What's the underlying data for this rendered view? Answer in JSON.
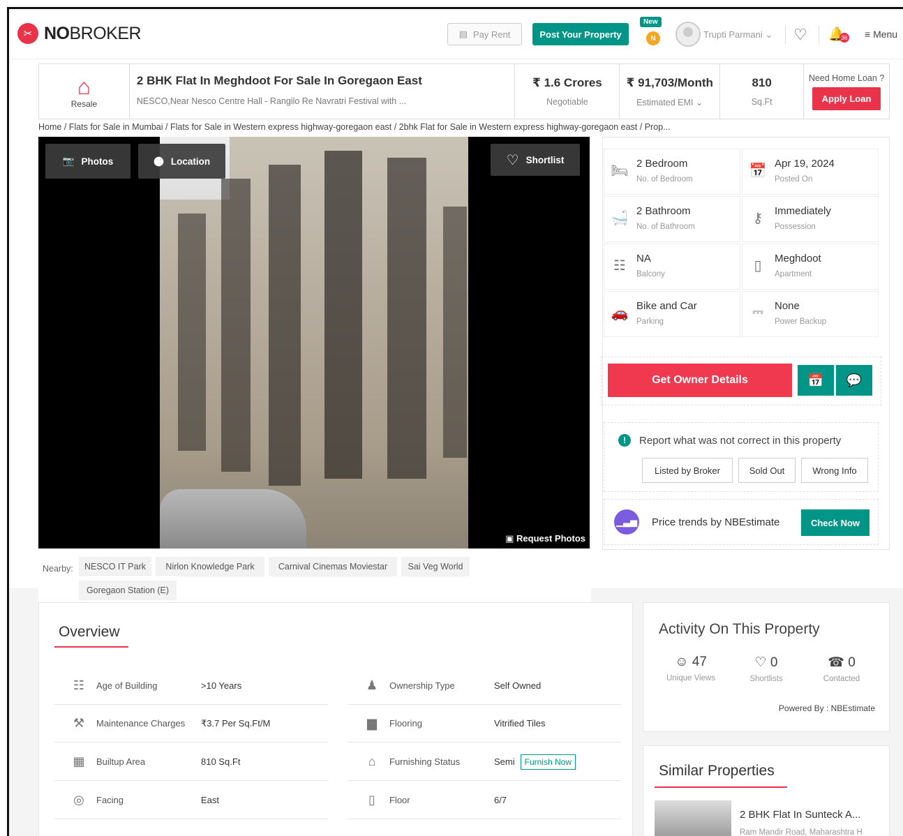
{
  "header": {
    "brand_no": "NO",
    "brand_rest": "BROKER",
    "pay_rent": "Pay Rent",
    "post_property": "Post Your Property",
    "new_badge": "New",
    "new_icon_letter": "N",
    "user_name": "Trupti Parmani",
    "notif_count": "36",
    "menu": "Menu"
  },
  "listing": {
    "resale_label": "Resale",
    "title": "2 BHK Flat In Meghdoot For Sale In Goregaon East",
    "address": "NESCO,Near Nesco Centre Hall - Rangilo Re Navratri Festival with ...",
    "price": "₹ 1.6 Crores",
    "price_sub": "Negotiable",
    "emi": "₹ 91,703/Month",
    "emi_sub": "Estimated EMI",
    "area": "810",
    "area_sub": "Sq.Ft",
    "loan_q": "Need Home Loan ?",
    "loan_btn": "Apply Loan"
  },
  "breadcrumb": "Home / Flats for Sale in Mumbai / Flats for Sale in Western express highway-goregaon east / 2bhk Flat for Sale in Western express highway-goregaon east / Prop...",
  "photo": {
    "photos_btn": "Photos",
    "location_btn": "Location",
    "shortlist_btn": "Shortlist",
    "request_photos": "Request Photos"
  },
  "details": [
    {
      "value": "2 Bedroom",
      "label": "No. of Bedroom",
      "icon": "bed-icon"
    },
    {
      "value": "Apr 19, 2024",
      "label": "Posted On",
      "icon": "calendar-icon"
    },
    {
      "value": "2 Bathroom",
      "label": "No. of Bathroom",
      "icon": "bath-icon"
    },
    {
      "value": "Immediately",
      "label": "Possession",
      "icon": "key-icon"
    },
    {
      "value": "NA",
      "label": "Balcony",
      "icon": "balcony-icon"
    },
    {
      "value": "Meghdoot",
      "label": "Apartment",
      "icon": "building-icon"
    },
    {
      "value": "Bike and Car",
      "label": "Parking",
      "icon": "car-icon"
    },
    {
      "value": "None",
      "label": "Power Backup",
      "icon": "battery-icon"
    }
  ],
  "owner_btn": "Get Owner Details",
  "report": {
    "text": "Report what was not correct in this property",
    "listed_by_broker": "Listed by Broker",
    "sold_out": "Sold Out",
    "wrong_info": "Wrong Info"
  },
  "trend": {
    "text": "Price trends by NBEstimate",
    "btn": "Check Now"
  },
  "nearby": {
    "label": "Nearby:",
    "items": [
      "NESCO IT Park",
      "Nirlon Knowledge Park",
      "Carnival Cinemas Moviestar",
      "Sai Veg World",
      "Goregaon Station (E)"
    ]
  },
  "overview": {
    "title": "Overview",
    "rows_left": [
      {
        "key": "Age of Building",
        "value": ">10 Years"
      },
      {
        "key": "Maintenance Charges",
        "value": "₹3.7 Per Sq.Ft/M"
      },
      {
        "key": "Builtup Area",
        "value": "810 Sq.Ft"
      },
      {
        "key": "Facing",
        "value": "East"
      }
    ],
    "rows_right": [
      {
        "key": "Ownership Type",
        "value": "Self Owned"
      },
      {
        "key": "Flooring",
        "value": "Vitrified Tiles"
      },
      {
        "key": "Furnishing Status",
        "value": "Semi"
      },
      {
        "key": "Floor",
        "value": "6/7"
      }
    ],
    "furnish_now": "Furnish Now"
  },
  "activity": {
    "title": "Activity On This Property",
    "unique_views": "47",
    "unique_views_label": "Unique Views",
    "shortlists": "0",
    "shortlists_label": "Shortlists",
    "contacted": "0",
    "contacted_label": "Contacted",
    "powered_by": "Powered By :",
    "powered_name": "NBEstimate"
  },
  "similar": {
    "title": "Similar Properties",
    "item_title": "2 BHK Flat In Sunteck A...",
    "item_sub": "Ram Mandir Road, Maharashtra H"
  },
  "colors": {
    "brand": "#e8334a",
    "teal": "#009587"
  }
}
